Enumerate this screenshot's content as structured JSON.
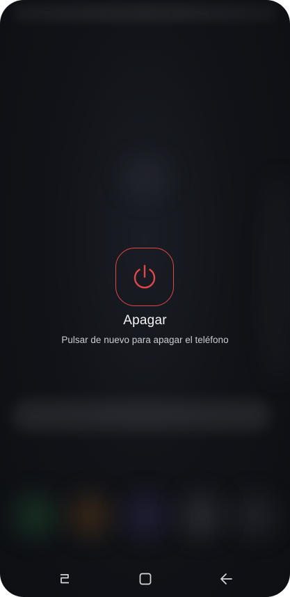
{
  "power_menu": {
    "title": "Apagar",
    "subtitle": "Pulsar de nuevo para apagar el teléfono",
    "accent_color": "#e2474b",
    "icon": "power-icon"
  },
  "navigation_bar": {
    "buttons": [
      {
        "name": "recents",
        "icon": "recents-icon"
      },
      {
        "name": "home",
        "icon": "home-icon"
      },
      {
        "name": "back",
        "icon": "back-icon"
      }
    ]
  }
}
